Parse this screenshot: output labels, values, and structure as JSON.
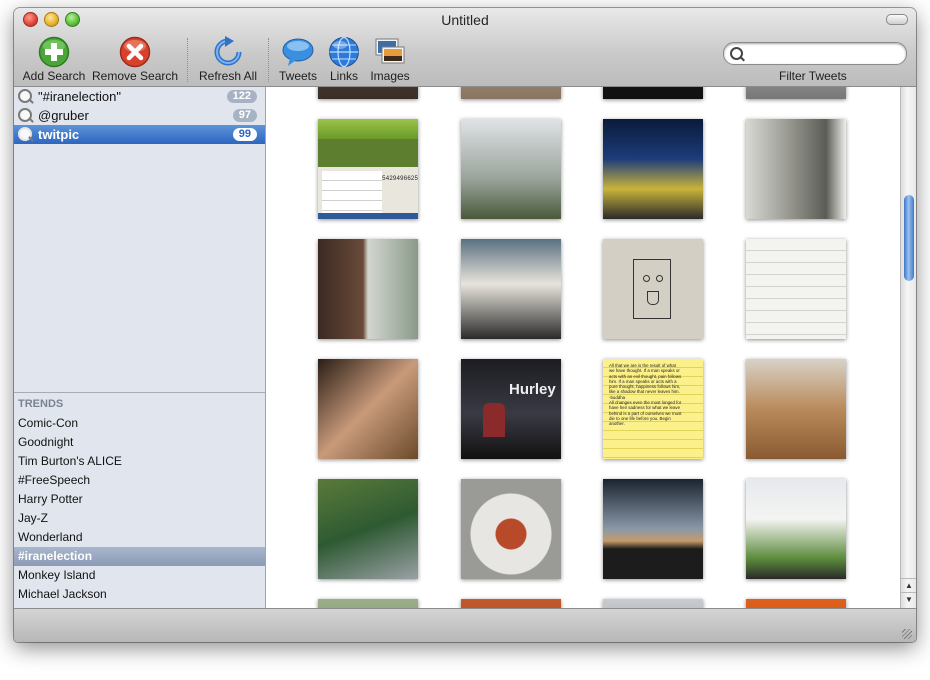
{
  "window": {
    "title": "Untitled"
  },
  "toolbar": {
    "add_search": "Add Search",
    "remove_search": "Remove Search",
    "refresh_all": "Refresh All",
    "tweets": "Tweets",
    "links": "Links",
    "images": "Images",
    "filter_label": "Filter Tweets",
    "filter_value": ""
  },
  "saved_searches": [
    {
      "label": "\"#iranelection\"",
      "count": "122",
      "selected": false
    },
    {
      "label": "@gruber",
      "count": "97",
      "selected": false
    },
    {
      "label": "twitpic",
      "count": "99",
      "selected": true
    }
  ],
  "trends": {
    "heading": "TRENDS",
    "items": [
      "Comic-Con",
      "Goodnight",
      "Tim Burton's ALICE",
      "#FreeSpeech",
      "Harry Potter",
      "Jay-Z",
      "Wonderland",
      "#iranelection",
      "Monkey Island",
      "Michael Jackson"
    ],
    "selected": "#iranelection"
  },
  "image_grid": {
    "rows": [
      [
        "website-screenshot",
        "tree-view",
        "exhibit-booth",
        "hallway-people"
      ],
      [
        "neck-closeup",
        "interview-crowd",
        "face-drawing",
        "notes-on-tiles"
      ],
      [
        "sneakers-on-legs",
        "hurley-guitarist",
        "quote-notepad",
        "sleeping-dog"
      ],
      [
        "balcony-table",
        "pasta-plate",
        "sunset-trees",
        "group-in-shirts"
      ]
    ],
    "text_visible": {
      "website_number": "5429496625",
      "hurley_sign": "Hurley",
      "notepad_lines": [
        "All that we are is the result of what",
        "we have thought. If a man speaks or",
        "acts with an evil thought, pain follows",
        "him. If a man speaks or acts with a",
        "pure thought, happiness follows him,",
        "like a shadow that never leaves him.",
        "-buddha",
        "",
        "All changes even the most longed for",
        "have heir sadness for what we leave",
        "behind is a part of ourselves we must",
        "die to one life before you. Begin",
        "another."
      ]
    }
  },
  "colors": {
    "selection": "#2c66c0",
    "badge": "#a7b3c4"
  }
}
